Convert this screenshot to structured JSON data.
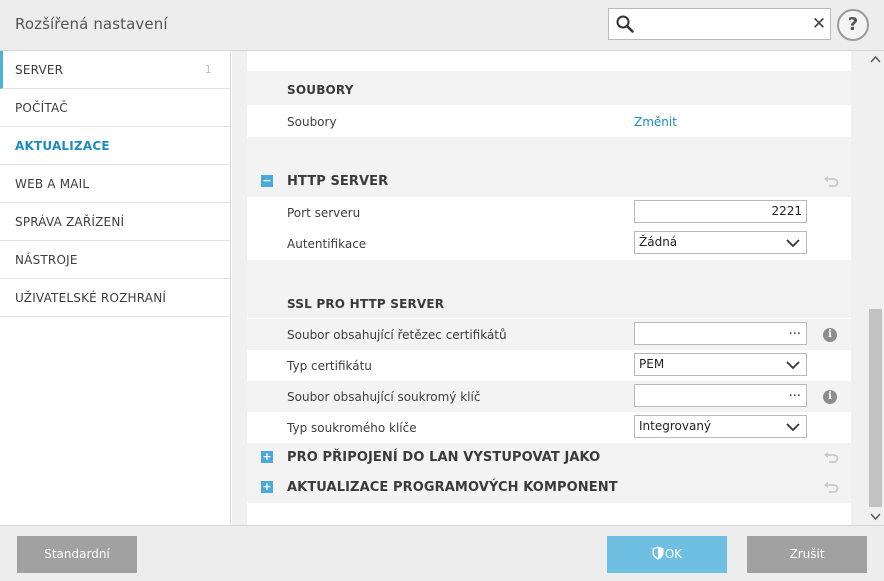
{
  "window": {
    "title": "Rozšířená nastavení",
    "search": {
      "value": "",
      "placeholder": ""
    },
    "help_label": "?"
  },
  "sidebar": {
    "items": [
      {
        "label": "SERVER",
        "count": "1"
      },
      {
        "label": "POČÍTAČ"
      },
      {
        "label": "AKTUALIZACE"
      },
      {
        "label": "WEB A MAIL"
      },
      {
        "label": "SPRÁVA ZAŘÍZENÍ"
      },
      {
        "label": "NÁSTROJE"
      },
      {
        "label": "UŽIVATELSKÉ ROZHRANÍ"
      }
    ]
  },
  "content": {
    "soubory": {
      "title": "SOUBORY",
      "files_label": "Soubory",
      "change_link": "Změnit"
    },
    "http_server": {
      "title": "HTTP SERVER",
      "expand_symbol": "−",
      "port_label": "Port serveru",
      "port_value": "2221",
      "auth_label": "Autentifikace",
      "auth_value": "Žádná"
    },
    "ssl": {
      "title": "SSL PRO HTTP SERVER",
      "cert_chain_label": "Soubor obsahující řetězec certifikátů",
      "cert_chain_value": "",
      "browse_symbol": "...",
      "cert_type_label": "Typ certifikátu",
      "cert_type_value": "PEM",
      "private_key_label": "Soubor obsahující soukromý klíč",
      "private_key_value": "",
      "private_key_type_label": "Typ soukromého klíče",
      "private_key_type_value": "Integrovaný",
      "info_symbol": "i"
    },
    "lan_section": {
      "title": "PRO PŘIPOJENÍ DO LAN VYSTUPOVAT JAKO",
      "expand_symbol": "+"
    },
    "components_section": {
      "title": "AKTUALIZACE PROGRAMOVÝCH KOMPONENT",
      "expand_symbol": "+"
    }
  },
  "footer": {
    "standard_label": "Standardní",
    "ok_label": "OK",
    "cancel_label": "Zrušit"
  },
  "colors": {
    "accent": "#1b8cbd",
    "ok_button": "#6fbfe3",
    "grey_button": "#a1a1a1",
    "expand_box": "#4aa9d6"
  },
  "icons": [
    "search-icon",
    "clear-icon",
    "help-icon",
    "collapse-icon",
    "expand-icon",
    "undo-icon",
    "info-icon",
    "chevron-down-icon",
    "shield-icon",
    "scroll-up-icon",
    "scroll-down-icon"
  ]
}
